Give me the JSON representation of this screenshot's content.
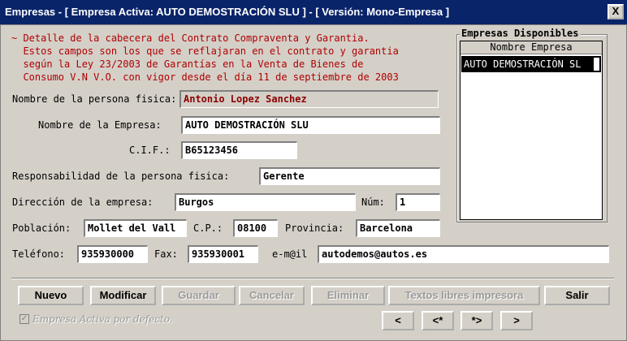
{
  "window": {
    "title": "Empresas - [ Empresa Activa: AUTO DEMOSTRACIÓN SLU ] - [ Versión: Mono-Empresa ]",
    "close_label": "X"
  },
  "note": "~ Detalle de la cabecera del Contrato Compraventa y Garantia.\n  Estos campos son los que se reflajaran en el contrato y garantia\n  según la Ley 23/2003 de Garantías en la Venta de Bienes de\n  Consumo V.N V.O. con vigor desde el día 11 de septiembre de 2003",
  "form": {
    "persona_label": "Nombre de la persona fisica:",
    "persona_value": "Antonio Lopez Sanchez",
    "empresa_label": "Nombre de la Empresa:",
    "empresa_value": "AUTO DEMOSTRACIÓN SLU",
    "cif_label": "C.I.F.:",
    "cif_value": "B65123456",
    "responsabilidad_label": "Responsabilidad de la persona fisica:",
    "responsabilidad_value": "Gerente",
    "direccion_label": "Dirección de la empresa:",
    "direccion_value": "Burgos",
    "num_label": "Núm:",
    "num_value": "1",
    "poblacion_label": "Población:",
    "poblacion_value": "Mollet del Vall",
    "cp_label": "C.P.:",
    "cp_value": "08100",
    "provincia_label": "Provincia:",
    "provincia_value": "Barcelona",
    "telefono_label": "Teléfono:",
    "telefono_value": "935930000",
    "fax_label": "Fax:",
    "fax_value": "935930001",
    "email_label": "e-m@il",
    "email_value": "autodemos@autos.es"
  },
  "empresas": {
    "group_title": "Empresas Disponibles",
    "column_header": "Nombre Empresa",
    "items": [
      "AUTO DEMOSTRACIÓN SL"
    ]
  },
  "buttons": {
    "nuevo": "Nuevo",
    "modificar": "Modificar",
    "guardar": "Guardar",
    "cancelar": "Cancelar",
    "eliminar": "Eliminar",
    "textos": "Textos libres impresora",
    "salir": "Salir",
    "first": "<",
    "prev": "<*",
    "next": "*>",
    "last": ">"
  },
  "checkbox": {
    "label": "Empresa Activa por defecto.",
    "checked": true
  }
}
